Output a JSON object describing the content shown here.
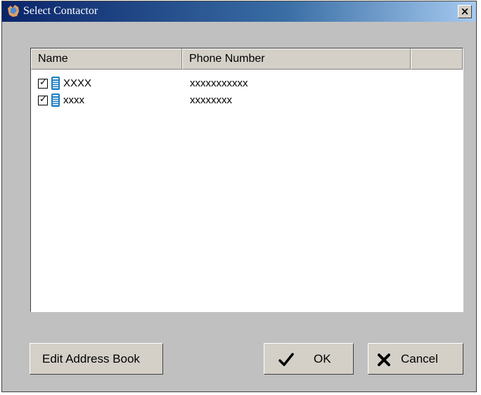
{
  "window": {
    "title": "Select Contactor",
    "close_label": "×"
  },
  "list": {
    "columns": [
      "Name",
      "Phone Number",
      ""
    ],
    "rows": [
      {
        "checked": true,
        "name": "XXXX",
        "phone": "xxxxxxxxxxx"
      },
      {
        "checked": true,
        "name": "xxxx",
        "phone": "xxxxxxxx"
      }
    ]
  },
  "buttons": {
    "edit_address_book": "Edit Address Book",
    "ok": "OK",
    "cancel": "Cancel"
  },
  "icons": {
    "title": "globe-icon",
    "row": "phone-icon",
    "ok": "checkmark-icon",
    "cancel": "x-icon"
  },
  "colors": {
    "titlebar_start": "#0a246a",
    "titlebar_end": "#a6caf0",
    "dialog_bg": "#c0c0c0",
    "phone_icon": "#1e7fc0"
  }
}
